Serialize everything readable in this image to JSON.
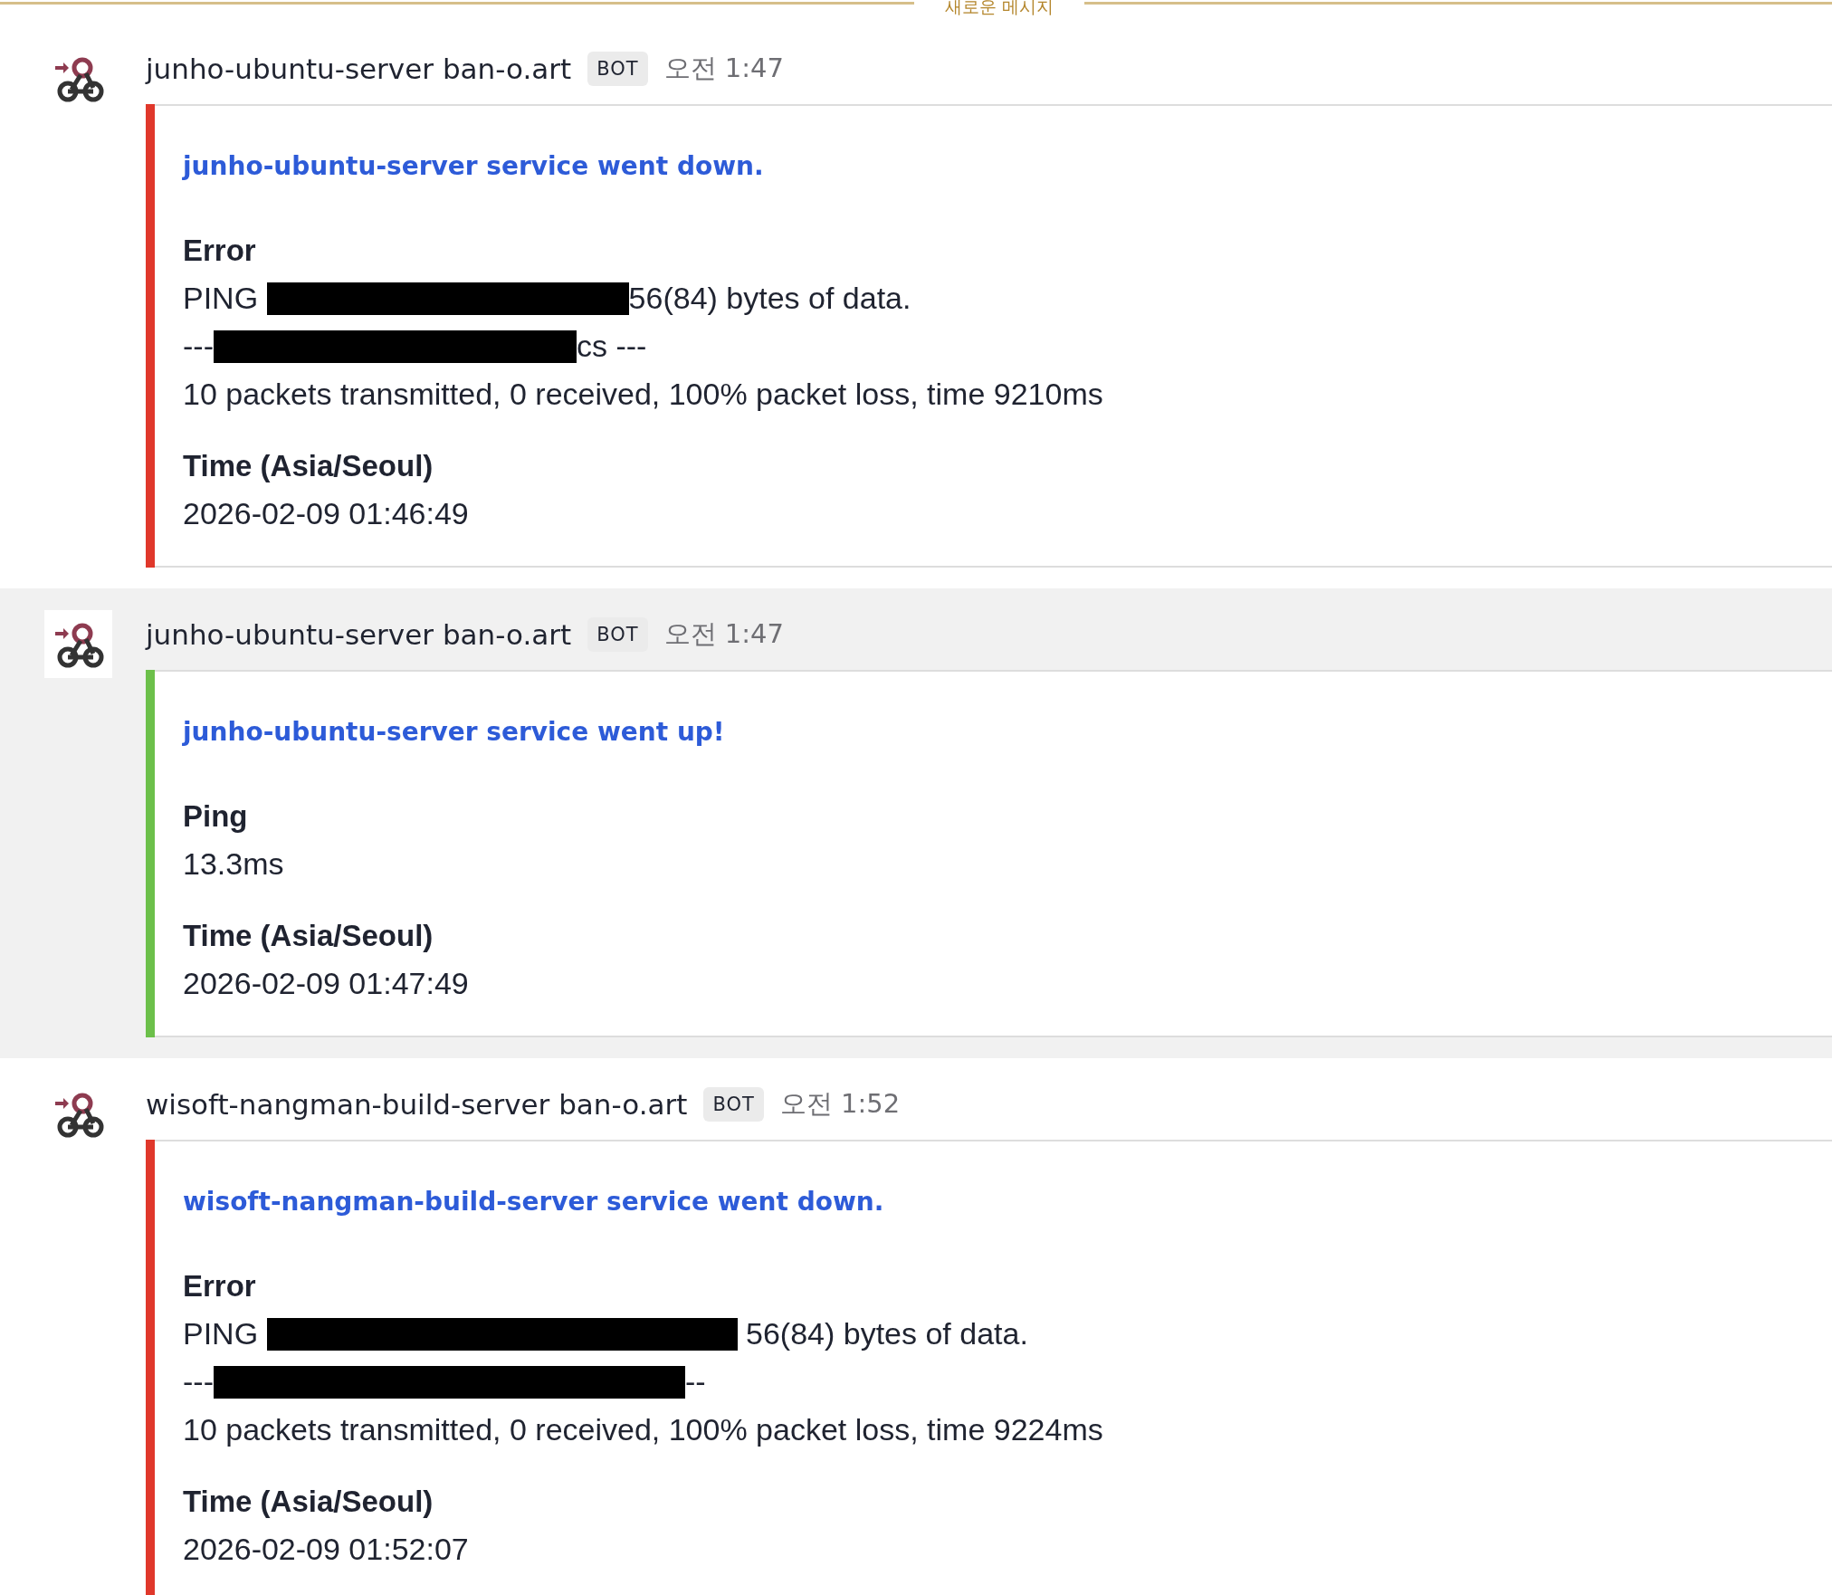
{
  "new_messages_divider": {
    "label": "새로운 메시지"
  },
  "messages": [
    {
      "sender": "junho-ubuntu-server ban-o.art",
      "badge": "BOT",
      "time": "오전 1:47",
      "selected": false,
      "attachment": {
        "color": "#e0382b",
        "title": "junho-ubuntu-server service went down.",
        "fields": [
          {
            "title": "Error",
            "lines": [
              [
                {
                  "kind": "text",
                  "text": "PING "
                },
                {
                  "kind": "redacted"
                },
                {
                  "kind": "text",
                  "text": "56(84) bytes of data."
                }
              ],
              [
                {
                  "kind": "text",
                  "text": "---"
                },
                {
                  "kind": "redacted"
                },
                {
                  "kind": "text",
                  "text": "cs ---"
                }
              ],
              [
                {
                  "kind": "text",
                  "text": "10 packets transmitted, 0 received, 100% packet loss, time 9210ms"
                }
              ]
            ]
          },
          {
            "title": "Time (Asia/Seoul)",
            "lines": [
              [
                {
                  "kind": "text",
                  "text": "2026-02-09 01:46:49"
                }
              ]
            ]
          }
        ]
      }
    },
    {
      "sender": "junho-ubuntu-server ban-o.art",
      "badge": "BOT",
      "time": "오전 1:47",
      "selected": true,
      "attachment": {
        "color": "#6cc04a",
        "title": "junho-ubuntu-server service went up!",
        "fields": [
          {
            "title": "Ping",
            "lines": [
              [
                {
                  "kind": "text",
                  "text": "13.3ms"
                }
              ]
            ]
          },
          {
            "title": "Time (Asia/Seoul)",
            "lines": [
              [
                {
                  "kind": "text",
                  "text": "2026-02-09 01:47:49"
                }
              ]
            ]
          }
        ]
      }
    },
    {
      "sender": "wisoft-nangman-build-server ban-o.art",
      "badge": "BOT",
      "time": "오전 1:52",
      "selected": false,
      "attachment": {
        "color": "#e0382b",
        "title": "wisoft-nangman-build-server service went down.",
        "fields": [
          {
            "title": "Error",
            "lines": [
              [
                {
                  "kind": "text",
                  "text": "PING "
                },
                {
                  "kind": "redacted"
                },
                {
                  "kind": "text",
                  "text": " 56(84) bytes of data."
                }
              ],
              [
                {
                  "kind": "text",
                  "text": "---"
                },
                {
                  "kind": "redacted"
                },
                {
                  "kind": "text",
                  "text": "--"
                }
              ],
              [
                {
                  "kind": "text",
                  "text": "10 packets transmitted, 0 received, 100% packet loss, time 9224ms"
                }
              ]
            ]
          },
          {
            "title": "Time (Asia/Seoul)",
            "lines": [
              [
                {
                  "kind": "text",
                  "text": "2026-02-09 01:52:07"
                }
              ]
            ]
          }
        ]
      }
    }
  ]
}
